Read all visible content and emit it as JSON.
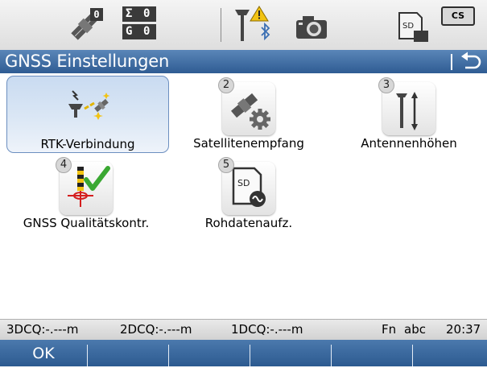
{
  "statusbar": {
    "satellite_count": "0",
    "sigma_label": "Σ",
    "sigma_value": "0",
    "g_label": "G",
    "g_value": "0",
    "cs_label": "CS",
    "sd_label": "SD",
    "icons": [
      "satellite-icon",
      "counter-icon",
      "radio-antenna-warning-icon",
      "bluetooth-icon",
      "camera-icon",
      "sd-card-icon",
      "cs-badge"
    ]
  },
  "title": {
    "text": "GNSS Einstellungen",
    "back_icon": "back-arrow-icon"
  },
  "menu": {
    "items": [
      {
        "number": "",
        "label": "RTK-Verbindung",
        "icon": "rtk-connection-icon",
        "selected": true
      },
      {
        "number": "2",
        "label": "Satellitenempfang",
        "icon": "satellite-gear-icon",
        "selected": false
      },
      {
        "number": "3",
        "label": "Antennenhöhen",
        "icon": "antenna-height-icon",
        "selected": false
      },
      {
        "number": "4",
        "label": "GNSS Qualitätskontr.",
        "icon": "quality-check-icon",
        "selected": false
      },
      {
        "number": "5",
        "label": "Rohdatenaufz.",
        "icon": "raw-data-sd-icon",
        "selected": false
      }
    ]
  },
  "infobar": {
    "dcq3": "3DCQ:-.---m",
    "dcq2": "2DCQ:-.---m",
    "dcq1": "1DCQ:-.---m",
    "fn": "Fn",
    "input_mode": "abc",
    "time": "20:37"
  },
  "fkeys": [
    "OK",
    "",
    "",
    "",
    "",
    ""
  ],
  "colors": {
    "title_bar": "#3a6aa3",
    "fkey_bar": "#3a6aa3",
    "selected_bg": "#d3e2f3",
    "check_green": "#3aa832"
  }
}
